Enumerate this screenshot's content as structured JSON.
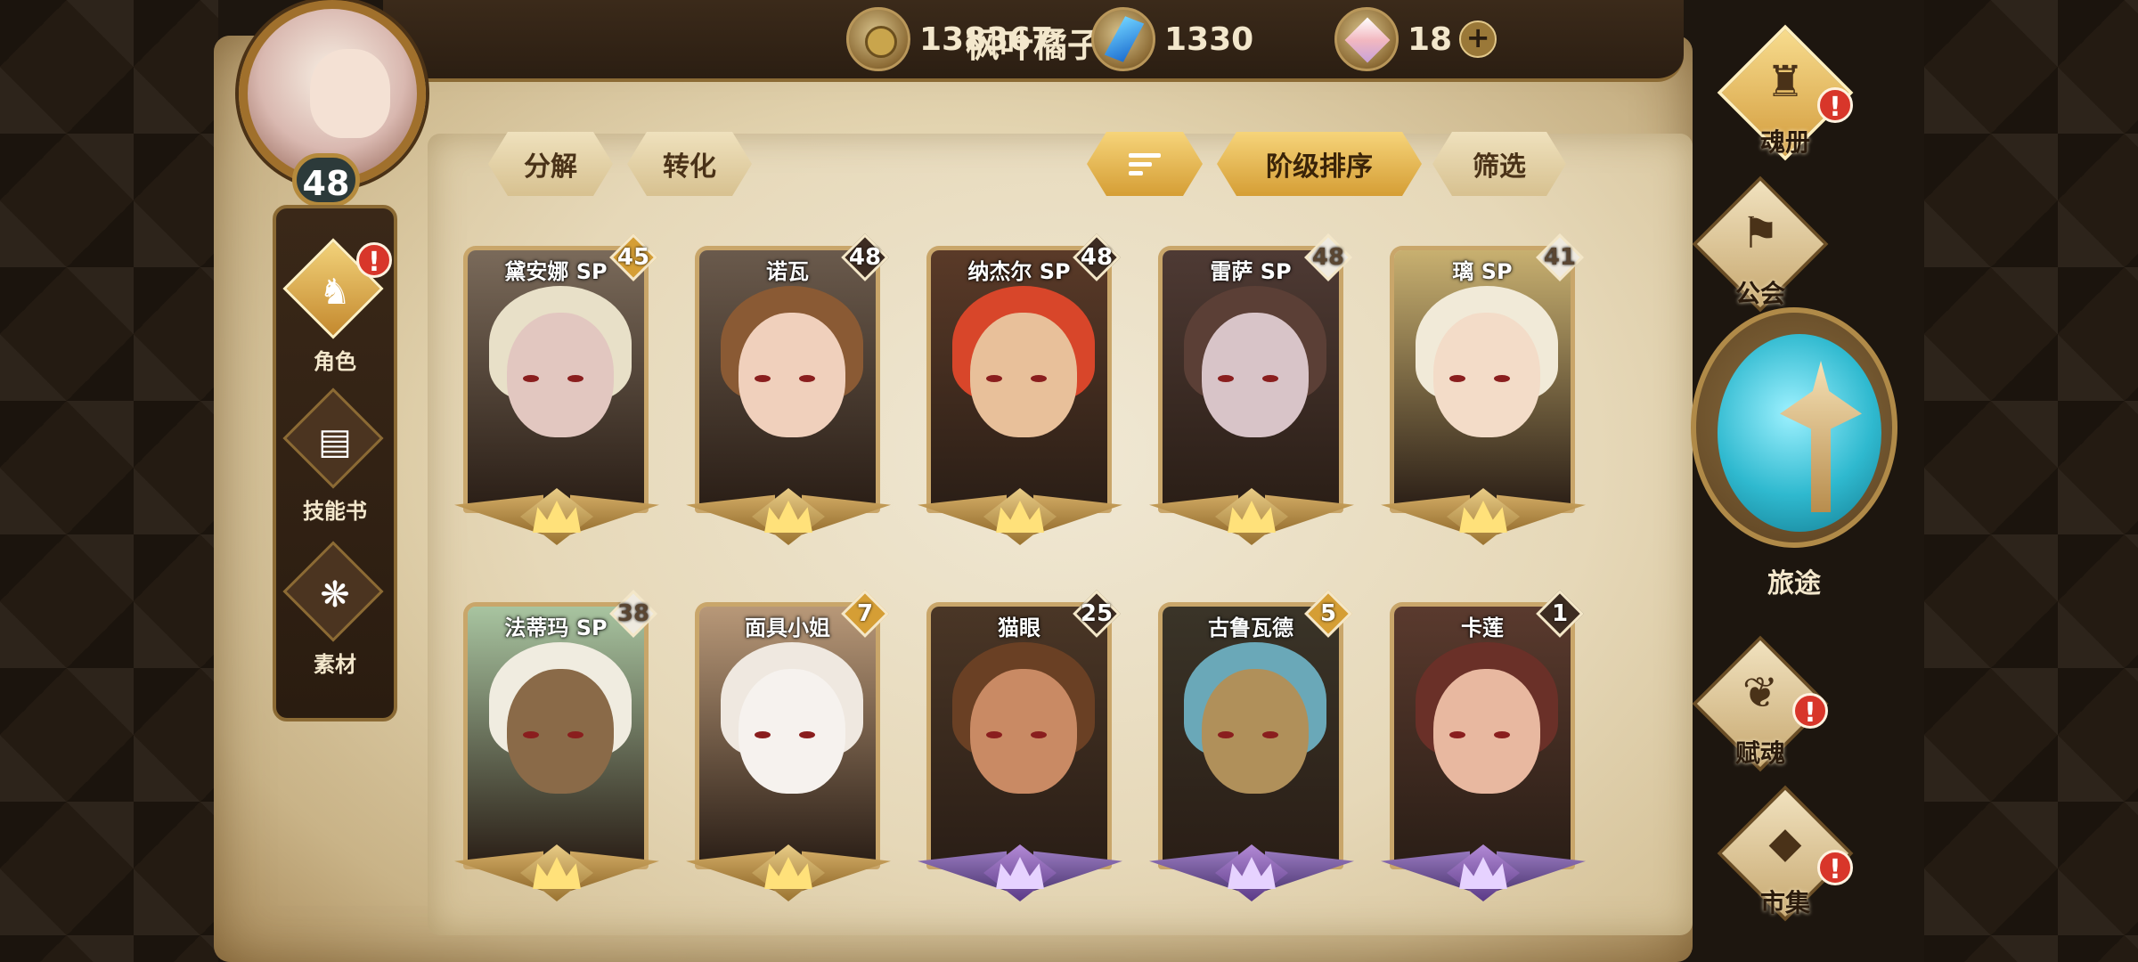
{
  "player": {
    "name": "枫叶橘子",
    "level": "48"
  },
  "resources": [
    {
      "icon": "gold-coin-icon",
      "value": "138367"
    },
    {
      "icon": "blue-gem-icon",
      "value": "1330"
    },
    {
      "icon": "soul-crystal-icon",
      "value": "18"
    }
  ],
  "add_symbol": "+",
  "actions": {
    "decompose": "分解",
    "convert": "转化",
    "sort_by_rank": "阶级排序",
    "filter": "筛选"
  },
  "left_nav": [
    {
      "label": "角色",
      "icon": "character-icon",
      "active": true,
      "alert": true
    },
    {
      "label": "技能书",
      "icon": "skill-book-icon",
      "active": false,
      "alert": false
    },
    {
      "label": "素材",
      "icon": "material-icon",
      "active": false,
      "alert": false
    }
  ],
  "alert_symbol": "!",
  "right_nav": [
    {
      "label": "魂册",
      "icon": "soul-book-icon",
      "alert": true,
      "active": true
    },
    {
      "label": "公会",
      "icon": "guild-icon",
      "alert": false,
      "active": false
    },
    {
      "label": "旅途",
      "icon": "journey-icon",
      "alert": false,
      "active": false
    },
    {
      "label": "赋魂",
      "icon": "soul-empower-icon",
      "alert": true,
      "active": false
    },
    {
      "label": "市集",
      "icon": "market-icon",
      "alert": true,
      "active": false
    }
  ],
  "characters": [
    {
      "name": "黛安娜 SP",
      "level": "45",
      "badge": "gold",
      "tier": "gold",
      "hair": "#e8e0c8",
      "skin": "#e2c7c0",
      "bg": "#7a6a5a"
    },
    {
      "name": "诺瓦",
      "level": "48",
      "badge": "dark",
      "tier": "gold",
      "hair": "#8a5a34",
      "skin": "#f0d0bc",
      "bg": "#6a5a4c"
    },
    {
      "name": "纳杰尔 SP",
      "level": "48",
      "badge": "dark",
      "tier": "gold",
      "hair": "#d8462a",
      "skin": "#e8c09a",
      "bg": "#5a3a28"
    },
    {
      "name": "雷萨 SP",
      "level": "48",
      "badge": "white",
      "tier": "gold",
      "hair": "#5b3f36",
      "skin": "#d8c4c8",
      "bg": "#4e3a34"
    },
    {
      "name": "璃 SP",
      "level": "41",
      "badge": "white",
      "tier": "gold",
      "hair": "#f1ead8",
      "skin": "#f3dcc8",
      "bg": "#c8b070"
    },
    {
      "name": "法蒂玛 SP",
      "level": "38",
      "badge": "white",
      "tier": "gold",
      "hair": "#f0ece0",
      "skin": "#8a6a48",
      "bg": "#a8c4a0"
    },
    {
      "name": "面具小姐",
      "level": "7",
      "badge": "gold",
      "tier": "gold",
      "hair": "#efe8e0",
      "skin": "#f6f2ee",
      "bg": "#b89878"
    },
    {
      "name": "猫眼",
      "level": "25",
      "badge": "dark",
      "tier": "purple",
      "hair": "#6a4024",
      "skin": "#c98a64",
      "bg": "#4a3626"
    },
    {
      "name": "古鲁瓦德",
      "level": "5",
      "badge": "gold",
      "tier": "purple",
      "hair": "#6aa8b8",
      "skin": "#b0905a",
      "bg": "#3a3428"
    },
    {
      "name": "卡莲",
      "level": "1",
      "badge": "dark",
      "tier": "purple",
      "hair": "#6a3028",
      "skin": "#e8b8a0",
      "bg": "#5a3a2e"
    }
  ]
}
